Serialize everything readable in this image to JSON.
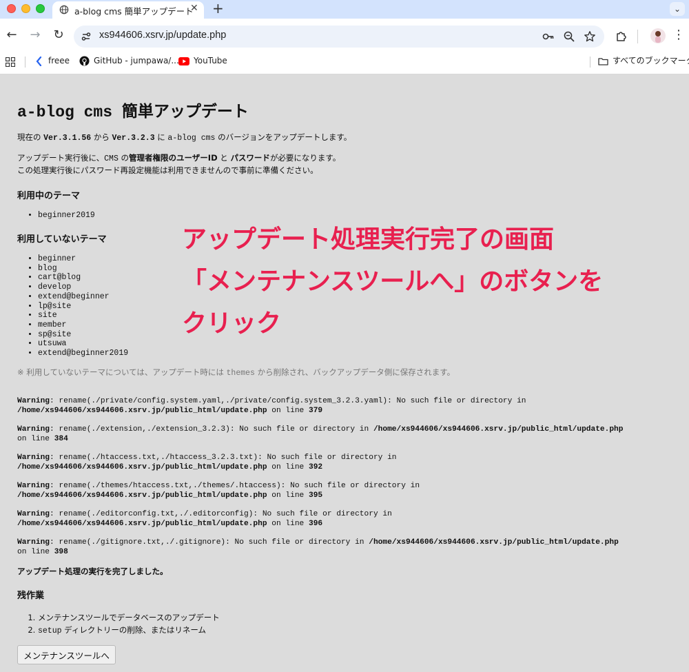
{
  "browser": {
    "tab_title": "a-blog cms 簡単アップデート",
    "url": "xs944606.xsrv.jp/update.php",
    "bookmarks": [
      {
        "label": "freee",
        "icon": "freee-icon"
      },
      {
        "label": "GitHub - jumpawa/...",
        "icon": "github-icon"
      },
      {
        "label": "YouTube",
        "icon": "youtube-icon"
      }
    ],
    "all_bookmarks": "すべてのブックマーク"
  },
  "page": {
    "title": "a-blog cms 簡単アップデート",
    "intro": {
      "part1": "現在の ",
      "from_version": "Ver.3.1.56",
      "part2": " から ",
      "to_version": "Ver.3.2.3",
      "part3": " に ",
      "product": "a-blog cms",
      "part4": " のバージョンをアップデートします。"
    },
    "notice": {
      "part1": "アップデート実行後に、",
      "cms": "CMS",
      "part2": " の",
      "bold1": "管理者権限のユーザーID",
      "part3": " と ",
      "bold2": "パスワード",
      "part4": "が必要になります。",
      "line2": "この処理実行後にパスワード再設定機能は利用できませんので事前に準備ください。"
    },
    "used_themes_heading": "利用中のテーマ",
    "used_themes": [
      "beginner2019"
    ],
    "unused_themes_heading": "利用していないテーマ",
    "unused_themes": [
      "beginner",
      "blog",
      "cart@blog",
      "develop",
      "extend@beginner",
      "lp@site",
      "site",
      "member",
      "sp@site",
      "utsuwa",
      "extend@beginner2019"
    ],
    "themes_note": {
      "part1": "※ 利用していないテーマについては、アップデート時には ",
      "code": "themes",
      "part2": " から削除され、バックアップデータ側に保存されます。"
    },
    "warnings": [
      {
        "label": "Warning",
        "message": ": rename(./private/config.system.yaml,./private/config.system_3.2.3.yaml): No such file or directory in",
        "file": "/home/xs944606/xs944606.xsrv.jp/public_html/update.php",
        "on_line": " on line ",
        "line": "379"
      },
      {
        "label": "Warning",
        "message": ": rename(./extension,./extension_3.2.3): No such file or directory in ",
        "file": "/home/xs944606/xs944606.xsrv.jp/public_html/update.php",
        "on_line": "on line ",
        "line": "384"
      },
      {
        "label": "Warning",
        "message": ": rename(./htaccess.txt,./htaccess_3.2.3.txt): No such file or directory in",
        "file": "/home/xs944606/xs944606.xsrv.jp/public_html/update.php",
        "on_line": " on line ",
        "line": "392"
      },
      {
        "label": "Warning",
        "message": ": rename(./themes/htaccess.txt,./themes/.htaccess): No such file or directory in",
        "file": "/home/xs944606/xs944606.xsrv.jp/public_html/update.php",
        "on_line": " on line ",
        "line": "395"
      },
      {
        "label": "Warning",
        "message": ": rename(./editorconfig.txt,./.editorconfig): No such file or directory in",
        "file": "/home/xs944606/xs944606.xsrv.jp/public_html/update.php",
        "on_line": " on line ",
        "line": "396"
      },
      {
        "label": "Warning",
        "message": ": rename(./gitignore.txt,./.gitignore): No such file or directory in ",
        "file": "/home/xs944606/xs944606.xsrv.jp/public_html/update.php",
        "on_line": "on line ",
        "line": "398"
      }
    ],
    "complete_message": "アップデート処理の実行を完了しました。",
    "remaining_heading": "残作業",
    "remaining_steps": [
      {
        "text": "メンテナンスツールでデータベースのアップデート"
      },
      {
        "code": "setup",
        "text": " ディレクトリーの削除、またはリネーム"
      }
    ],
    "maintenance_button": "メンテナンスツールへ"
  },
  "annotation": {
    "line1": "アップデート処理実行完了の画面",
    "line2": "「メンテナンスツールへ」のボタンを",
    "line3": "クリック",
    "color": "#e8204f"
  }
}
